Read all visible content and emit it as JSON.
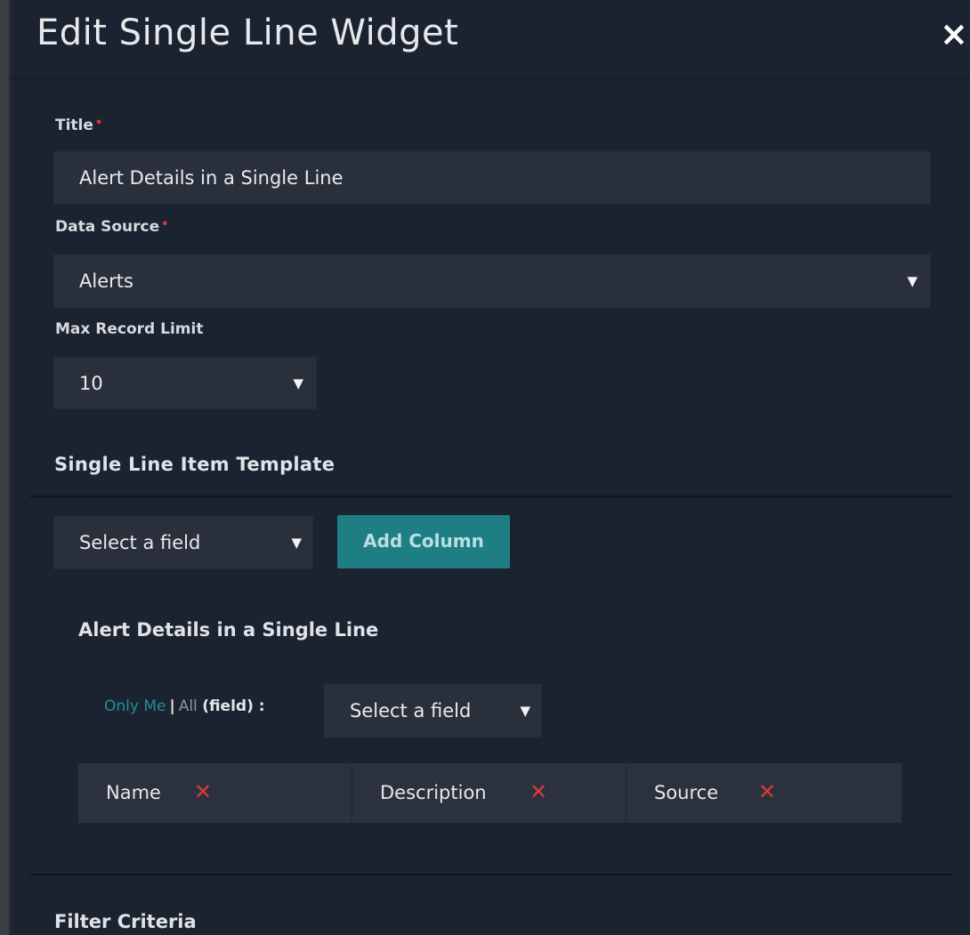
{
  "modal": {
    "title": "Edit Single Line Widget",
    "close_label": "×"
  },
  "form": {
    "title_label": "Title",
    "title_value": "Alert Details in a Single Line",
    "data_source_label": "Data Source",
    "data_source_value": "Alerts",
    "max_record_label": "Max Record Limit",
    "max_record_value": "10",
    "required_marker": "•"
  },
  "template": {
    "section_title": "Single Line Item Template",
    "field_select_value": "Select a field",
    "add_column_label": "Add Column",
    "preview_title": "Alert Details in a Single Line",
    "scope_only_me": "Only Me",
    "scope_sep": "|",
    "scope_all": "All",
    "scope_field": "(field) :",
    "scope_select_value": "Select a field",
    "columns": [
      {
        "name": "Name",
        "remove": "✕"
      },
      {
        "name": "Description",
        "remove": "✕"
      },
      {
        "name": "Source",
        "remove": "✕"
      }
    ]
  },
  "filter": {
    "section_title": "Filter Criteria"
  },
  "icons": {
    "caret": "▼",
    "close": "close-icon",
    "remove": "remove-x-icon"
  },
  "colors": {
    "accent": "#1e7e84",
    "link": "#1f8f98",
    "danger": "#d83a3f",
    "background": "#1c2330"
  }
}
